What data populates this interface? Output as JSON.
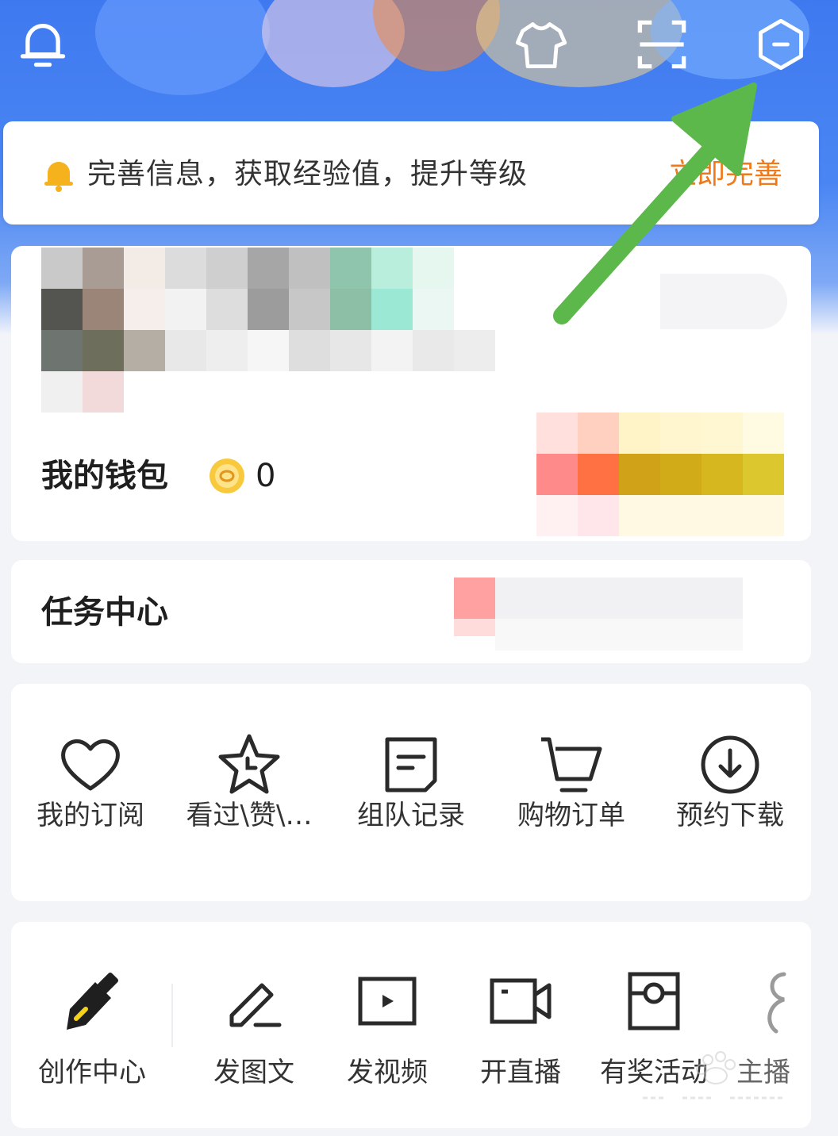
{
  "header": {
    "icons": [
      "bell-icon",
      "outfit-icon",
      "scan-icon",
      "settings-hex-icon"
    ]
  },
  "notice": {
    "text": "完善信息，获取经验值，提升等级",
    "action": "立即完善",
    "accent": "#f07a1a"
  },
  "wallet": {
    "label": "我的钱包",
    "coin_value": "0"
  },
  "task_center": {
    "label": "任务中心"
  },
  "shortcuts": [
    {
      "label": "我的订阅",
      "icon": "heart-icon"
    },
    {
      "label": "看过\\赞\\…",
      "icon": "star-clock-icon"
    },
    {
      "label": "组队记录",
      "icon": "note-icon"
    },
    {
      "label": "购物订单",
      "icon": "cart-icon"
    },
    {
      "label": "预约下载",
      "icon": "download-icon"
    }
  ],
  "creator": [
    {
      "label": "创作中心",
      "icon": "pen-nib-icon"
    },
    {
      "label": "发图文",
      "icon": "edit-icon"
    },
    {
      "label": "发视频",
      "icon": "video-icon"
    },
    {
      "label": "开直播",
      "icon": "live-camera-icon"
    },
    {
      "label": "有奖活动",
      "icon": "gift-icon"
    },
    {
      "label": "主播",
      "icon": "anchor-icon"
    }
  ],
  "colors": {
    "header_blue": "#3f79f0",
    "annotation_arrow": "#5cb84a"
  }
}
